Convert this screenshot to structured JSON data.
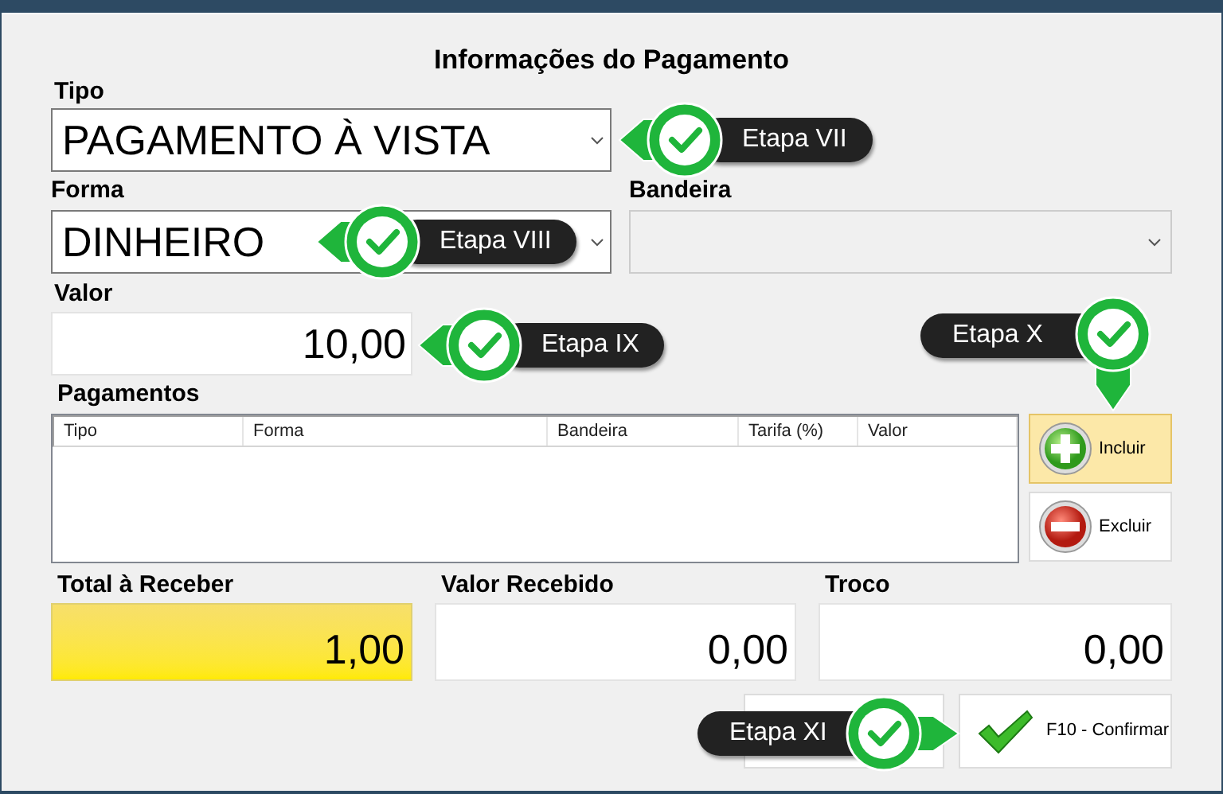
{
  "title": "Informações do Pagamento",
  "tipo": {
    "label": "Tipo",
    "value": "PAGAMENTO À VISTA"
  },
  "forma": {
    "label": "Forma",
    "value": "DINHEIRO"
  },
  "bandeira": {
    "label": "Bandeira",
    "disabled": true
  },
  "valor": {
    "label": "Valor",
    "value": "10,00"
  },
  "pagamentos": {
    "label": "Pagamentos",
    "columns": [
      "Tipo",
      "Forma",
      "Bandeira",
      "Tarifa (%)",
      "Valor"
    ]
  },
  "side_buttons": [
    {
      "label": "Incluir",
      "kind": "add",
      "selected": true
    },
    {
      "label": "Excluir",
      "kind": "remove",
      "selected": false
    }
  ],
  "totals": [
    {
      "label": "Total à Receber",
      "value": "1,00",
      "highlighted": true
    },
    {
      "label": "Valor Recebido",
      "value": "0,00",
      "highlighted": false
    },
    {
      "label": "Troco",
      "value": "0,00",
      "highlighted": false
    }
  ],
  "confirm_button": {
    "label": "F10 - Confirmar"
  },
  "callouts": [
    {
      "label": "Etapa VII",
      "kind": "left"
    },
    {
      "label": "Etapa VIII",
      "kind": "left"
    },
    {
      "label": "Etapa IX",
      "kind": "left"
    },
    {
      "label": "Etapa X",
      "kind": "down"
    },
    {
      "label": "Etapa XI",
      "kind": "right"
    }
  ]
}
